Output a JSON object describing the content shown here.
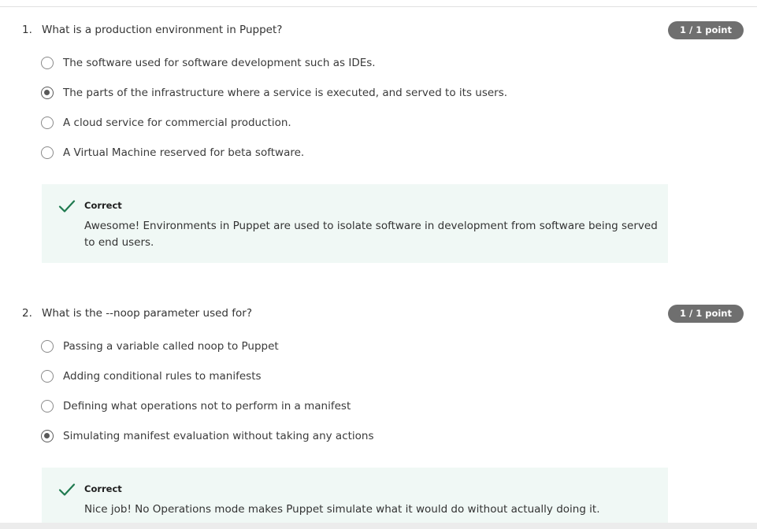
{
  "questions": [
    {
      "number": "1.",
      "text": "What is a production environment in Puppet?",
      "points": "1 / 1 point",
      "options": [
        {
          "label": "The software used for software development such as IDEs.",
          "selected": false
        },
        {
          "label": "The parts of the infrastructure where a service is executed, and served to its users.",
          "selected": true
        },
        {
          "label": "A cloud service for commercial production.",
          "selected": false
        },
        {
          "label": "A Virtual Machine reserved for beta software.",
          "selected": false
        }
      ],
      "feedback": {
        "title": "Correct",
        "body": "Awesome! Environments in Puppet are used to isolate software in development from software being served to end users."
      }
    },
    {
      "number": "2.",
      "text": "What is the --noop parameter used for?",
      "points": "1 / 1 point",
      "options": [
        {
          "label": "Passing a variable called noop to Puppet",
          "selected": false
        },
        {
          "label": "Adding conditional rules to manifests",
          "selected": false
        },
        {
          "label": "Defining what operations not to perform in a manifest",
          "selected": false
        },
        {
          "label": "Simulating manifest evaluation without taking any actions",
          "selected": true
        }
      ],
      "feedback": {
        "title": "Correct",
        "body": "Nice job! No Operations mode makes Puppet simulate what it would do without actually doing it."
      }
    }
  ],
  "colors": {
    "badge": "#6f6f6f",
    "feedback_bg": "#f0f8f5",
    "check": "#1f7a4f"
  },
  "icons": {
    "check": "check-icon",
    "radio": "radio-button"
  }
}
